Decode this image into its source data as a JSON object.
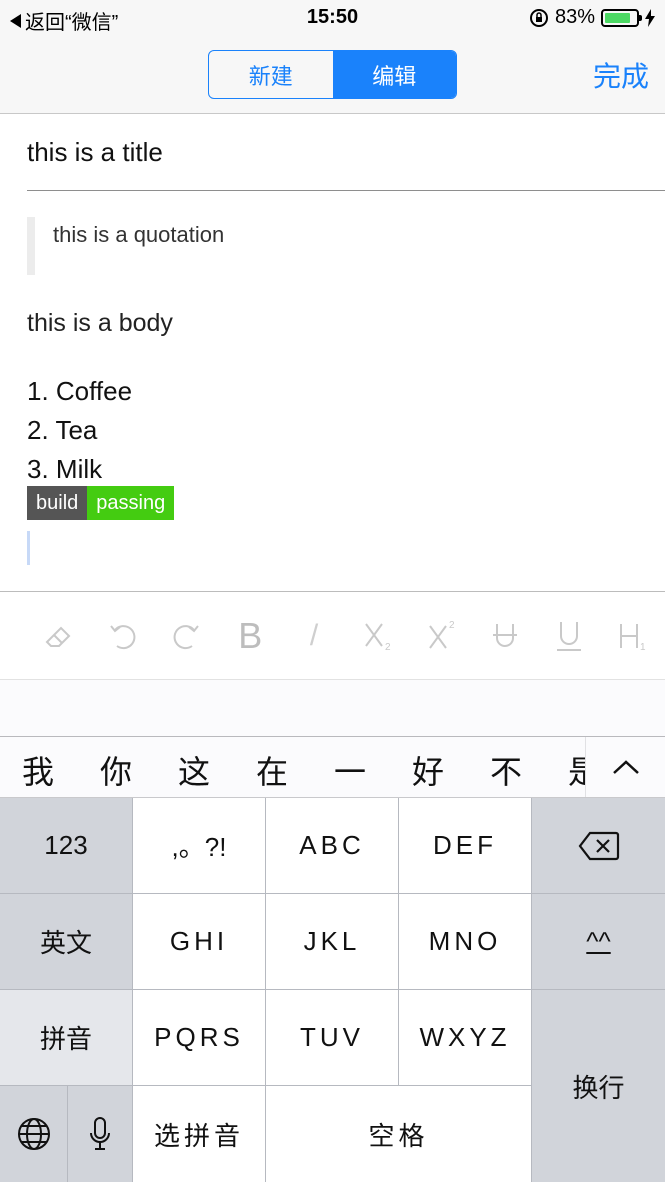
{
  "status_bar": {
    "back_label": "返回“微信”",
    "time": "15:50",
    "battery_percent": "83%",
    "battery_color": "#4cd964"
  },
  "nav": {
    "segments": [
      "新建",
      "编辑"
    ],
    "active_segment": "编辑",
    "done_label": "完成",
    "accent_color": "#1a82fb"
  },
  "editor": {
    "title": "this is a title",
    "quotation": "this is a quotation",
    "body": "this is a body",
    "list_items": [
      "1. Coffee",
      "2. Tea",
      "3. Milk"
    ],
    "badge": {
      "left": "build",
      "right": "passing",
      "right_color": "#44cc11"
    }
  },
  "toolbar": {
    "icons": [
      "eraser-icon",
      "undo-icon",
      "redo-icon",
      "bold-icon",
      "italic-icon",
      "subscript-icon",
      "superscript-icon",
      "strikethrough-icon",
      "underline-icon",
      "heading-icon"
    ],
    "bold_glyph": "B",
    "italic_glyph": "/"
  },
  "candidates": [
    "我",
    "你",
    "这",
    "在",
    "一",
    "好",
    "不",
    "是"
  ],
  "keyboard": {
    "row1": [
      "123",
      ",。?!",
      "ABC",
      "DEF"
    ],
    "row2": [
      "英文",
      "GHI",
      "JKL",
      "MNO",
      "^^"
    ],
    "row3": [
      "拼音",
      "PQRS",
      "TUV",
      "WXYZ"
    ],
    "return_label": "换行",
    "row4": [
      "选拼音",
      "空格"
    ],
    "icons": [
      "backspace-icon",
      "globe-icon",
      "microphone-icon",
      "chevron-up-icon"
    ]
  }
}
